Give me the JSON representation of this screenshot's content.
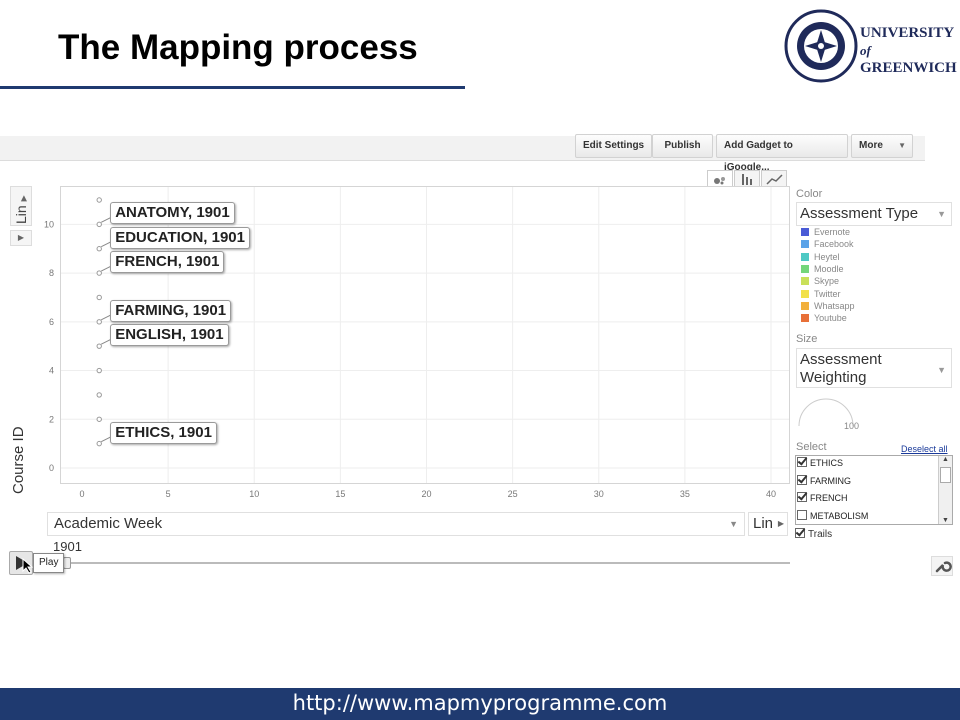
{
  "slide": {
    "title": "The Mapping process",
    "footer_url": "http://www.mapmyprogramme.com",
    "accent_color": "#1f3a70"
  },
  "logo": {
    "line1": "UNIVERSITY",
    "line2": "of",
    "line3": "GREENWICH",
    "seal_text": "UNIVERSITY OF GREENWICH"
  },
  "toolbar": {
    "edit_settings": "Edit Settings",
    "publish": "Publish",
    "add_gadget": "Add Gadget to iGoogle...",
    "more": "More"
  },
  "chart_tabs": [
    "bubble-chart-icon",
    "bar-chart-icon",
    "line-chart-icon"
  ],
  "y_axis": {
    "scale_label": "Lin",
    "title": "Course ID"
  },
  "x_axis": {
    "variable": "Academic Week",
    "scale_label": "Lin"
  },
  "playback": {
    "current_time": "1901",
    "play_tooltip": "Play"
  },
  "color_panel": {
    "label": "Color",
    "value": "Assessment Type",
    "legend": [
      {
        "name": "Evernote",
        "color": "#4a5bd6"
      },
      {
        "name": "Facebook",
        "color": "#5aa3e8"
      },
      {
        "name": "Heytel",
        "color": "#4ec9c4"
      },
      {
        "name": "Moodle",
        "color": "#74d67a"
      },
      {
        "name": "Skype",
        "color": "#c9e05a"
      },
      {
        "name": "Twitter",
        "color": "#f2e14a"
      },
      {
        "name": "Whatsapp",
        "color": "#f2b03c"
      },
      {
        "name": "Youtube",
        "color": "#e87038"
      }
    ]
  },
  "size_panel": {
    "label": "Size",
    "value": "Assessment Weighting",
    "gauge_value": "100"
  },
  "select_panel": {
    "label": "Select",
    "deselect": "Deselect all",
    "items": [
      {
        "name": "ETHICS",
        "checked": true
      },
      {
        "name": "FARMING",
        "checked": true
      },
      {
        "name": "FRENCH",
        "checked": true
      },
      {
        "name": "METABOLISM",
        "checked": false
      }
    ],
    "trails_label": "Trails",
    "trails_checked": true
  },
  "chart_data": {
    "type": "scatter",
    "xlabel": "Academic Week",
    "ylabel": "Course ID",
    "xlim": [
      0,
      40
    ],
    "ylim": [
      0,
      11
    ],
    "x_ticks": [
      0,
      5,
      10,
      15,
      20,
      25,
      30,
      35,
      40
    ],
    "y_ticks": [
      0,
      2,
      4,
      6,
      8,
      10
    ],
    "points": [
      {
        "x": 1,
        "y": 11
      },
      {
        "x": 1,
        "y": 10
      },
      {
        "x": 1,
        "y": 9
      },
      {
        "x": 1,
        "y": 8
      },
      {
        "x": 1,
        "y": 7
      },
      {
        "x": 1,
        "y": 6
      },
      {
        "x": 1,
        "y": 5
      },
      {
        "x": 1,
        "y": 4
      },
      {
        "x": 1,
        "y": 3
      },
      {
        "x": 1,
        "y": 2
      },
      {
        "x": 1,
        "y": 1
      }
    ],
    "annotations": [
      {
        "text": "ANATOMY, 1901",
        "x": 1,
        "y": 10
      },
      {
        "text": "EDUCATION, 1901",
        "x": 1,
        "y": 9
      },
      {
        "text": "FRENCH, 1901",
        "x": 1,
        "y": 8
      },
      {
        "text": "FARMING, 1901",
        "x": 1,
        "y": 6
      },
      {
        "text": "ENGLISH, 1901",
        "x": 1,
        "y": 5
      },
      {
        "text": "ETHICS, 1901",
        "x": 1,
        "y": 1
      }
    ]
  }
}
